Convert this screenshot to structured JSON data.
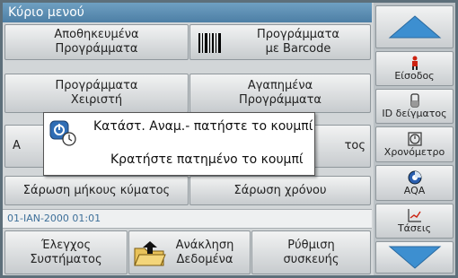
{
  "title": "Κύριο μενού",
  "main_buttons": {
    "stored_programs": "Αποθηκευμένα\nΠρογράμματα",
    "barcode_programs": "Προγράμματα\nμε Barcode",
    "user_programs": "Προγράμματα\nΧειριστή",
    "favorite_programs": "Αγαπημένα\nΠρογράμματα",
    "single_wavelength_partial": "Α",
    "multi_wavelength_partial": "τος",
    "wavelength_scan": "Σάρωση μήκους κύματος",
    "time_scan": "Σάρωση χρόνου"
  },
  "datetime": "01-ΙΑΝ-2000  01:01",
  "bottom_buttons": {
    "system_check": "Έλεγχος\nΣυστήματος",
    "recall_data": "Ανάκληση\nΔεδομένα",
    "instrument_setup": "Ρύθμιση\nσυσκευής"
  },
  "sidebar": {
    "login": "Είσοδος",
    "sample_id": "ID δείγματος",
    "timer": "Χρονόμετρο",
    "aqa": "AQA",
    "trends": "Τάσεις"
  },
  "dialog": {
    "line1": "Κατάστ. Αναμ.- πατήστε το κουμπί",
    "line2": "Κρατήστε πατημένο το κουμπί"
  },
  "colors": {
    "title_bar": "#4d7fa5",
    "arrow": "#3d8fd0",
    "date_text": "#3d6f99"
  },
  "icons": {
    "barcode": "barcode-icon",
    "folder": "folder-upload-icon",
    "login": "person-icon",
    "sample_id": "tube-icon",
    "timer": "stopwatch-icon",
    "aqa": "aqa-icon",
    "trends": "chart-trend-icon",
    "standby": "power-standby-icon"
  }
}
